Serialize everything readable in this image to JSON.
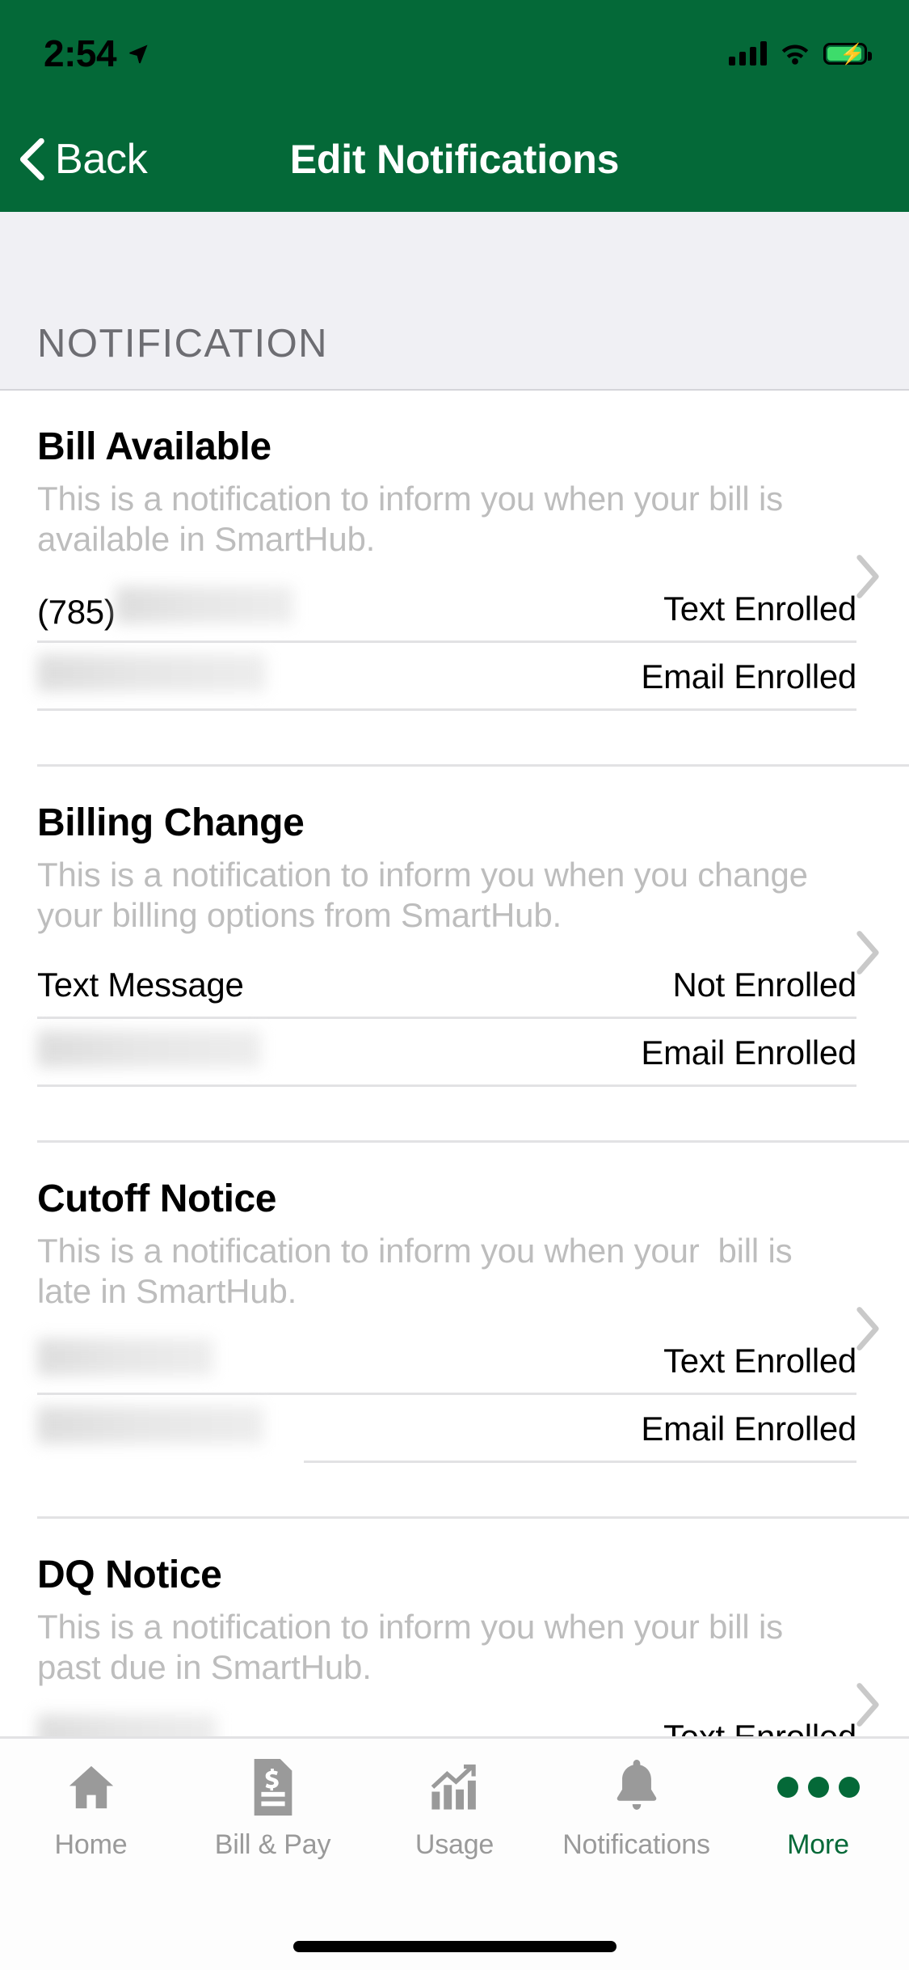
{
  "status_bar": {
    "time": "2:54",
    "location_icon": "location-arrow-icon",
    "signal_icon": "cellular-signal-icon",
    "wifi_icon": "wifi-icon",
    "battery_icon": "battery-charging-icon"
  },
  "nav": {
    "back_label": "Back",
    "back_icon": "chevron-left-icon",
    "title": "Edit Notifications"
  },
  "section": {
    "header": "NOTIFICATION"
  },
  "notifications": [
    {
      "title": "Bill Available",
      "description": "This is a notification to inform you when your bill is available in SmartHub.",
      "rows": [
        {
          "left": "(785)",
          "left_redacted": true,
          "redact_width": 220,
          "right": "Text Enrolled",
          "indent": false
        },
        {
          "left": "",
          "left_redacted": true,
          "redact_width": 283,
          "right": "Email Enrolled",
          "indent": false
        }
      ]
    },
    {
      "title": "Billing Change",
      "description": "This is a notification to inform you when you change your billing options from SmartHub.",
      "rows": [
        {
          "left": "Text Message",
          "left_redacted": false,
          "redact_width": 0,
          "right": "Not Enrolled",
          "indent": false
        },
        {
          "left": "",
          "left_redacted": true,
          "redact_width": 277,
          "right": "Email Enrolled",
          "indent": false
        }
      ]
    },
    {
      "title": "Cutoff Notice",
      "description": "This is a notification to inform you when your  bill is late in SmartHub.",
      "rows": [
        {
          "left": "",
          "left_redacted": true,
          "redact_width": 218,
          "right": "Text Enrolled",
          "indent": false
        },
        {
          "left": "",
          "left_redacted": true,
          "redact_width": 280,
          "right": "Email Enrolled",
          "indent": true
        }
      ]
    },
    {
      "title": "DQ Notice",
      "description": "This is a notification to inform you when your bill is past due in SmartHub.",
      "rows": [
        {
          "left": "",
          "left_redacted": true,
          "redact_width": 222,
          "right": "Text Enrolled",
          "indent": false
        }
      ]
    }
  ],
  "tabbar": {
    "items": [
      {
        "label": "Home",
        "icon": "home-icon",
        "active": false
      },
      {
        "label": "Bill & Pay",
        "icon": "invoice-dollar-icon",
        "active": false
      },
      {
        "label": "Usage",
        "icon": "bar-chart-trend-icon",
        "active": false
      },
      {
        "label": "Notifications",
        "icon": "bell-icon",
        "active": false
      },
      {
        "label": "More",
        "icon": "three-dots-icon",
        "active": true
      }
    ]
  },
  "colors": {
    "brand_green": "#046938",
    "section_bg": "#f0f0f4",
    "muted_text": "#bdbdbd",
    "separator": "#e2e2e4"
  }
}
